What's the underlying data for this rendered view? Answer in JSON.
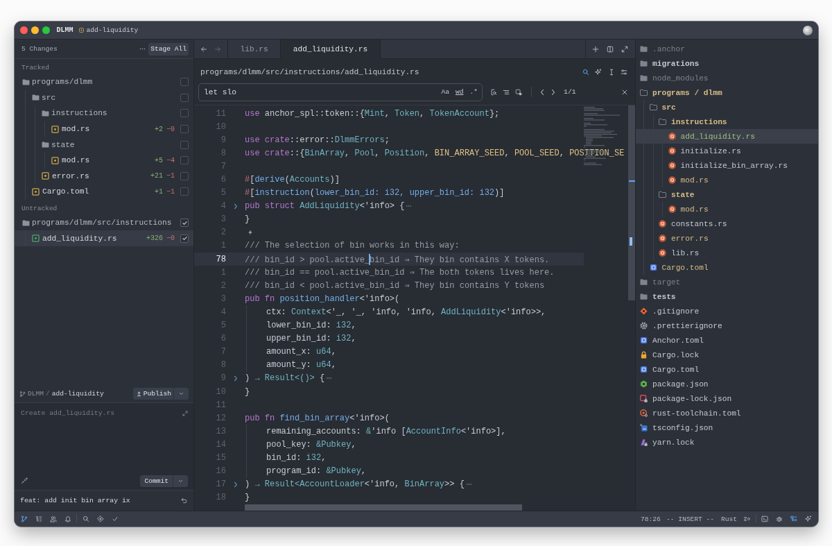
{
  "window": {
    "title": "DLMM",
    "branch": "add-liquidity"
  },
  "git_panel": {
    "summary": "5 Changes",
    "stage_all": "Stage All",
    "sections": [
      {
        "title": "Tracked",
        "items": [
          {
            "kind": "folder",
            "name": "programs/dlmm",
            "checked": false,
            "selected": false,
            "children": [
              {
                "kind": "folder",
                "name": "src",
                "checked": false,
                "selected": false,
                "children": [
                  {
                    "kind": "folder",
                    "name": "instructions",
                    "checked": false,
                    "selected": false,
                    "children": [
                      {
                        "kind": "file",
                        "name": "mod.rs",
                        "new_file": false,
                        "additions": "+2",
                        "deletions": "−0",
                        "checked": false,
                        "selected": false
                      }
                    ]
                  },
                  {
                    "kind": "folder",
                    "name": "state",
                    "checked": false,
                    "selected": false,
                    "children": [
                      {
                        "kind": "file",
                        "name": "mod.rs",
                        "new_file": false,
                        "additions": "+5",
                        "deletions": "−4",
                        "checked": false,
                        "selected": false
                      }
                    ]
                  },
                  {
                    "kind": "file",
                    "name": "error.rs",
                    "new_file": false,
                    "additions": "+21",
                    "deletions": "−1",
                    "checked": false,
                    "selected": false
                  }
                ]
              },
              {
                "kind": "file",
                "name": "Cargo.toml",
                "new_file": false,
                "additions": "+1",
                "deletions": "−1",
                "checked": false,
                "selected": false
              }
            ]
          }
        ]
      },
      {
        "title": "Untracked",
        "items": [
          {
            "kind": "folder",
            "name": "programs/dlmm/src/instructions",
            "checked": true,
            "selected": false,
            "children": [
              {
                "kind": "file",
                "name": "add_liquidity.rs",
                "new_file": true,
                "additions": "+326",
                "deletions": "−0",
                "checked": true,
                "selected": true
              }
            ]
          }
        ]
      }
    ],
    "repository": "DLMM",
    "separator": "/",
    "branch": "add-liquidity",
    "publish": "Publish",
    "commit_message": {
      "placeholder": "Create add_liquidity.rs"
    },
    "commit": "Commit",
    "last_commit": "feat: add init bin array ix"
  },
  "editor": {
    "back_enabled": true,
    "forward_enabled": false,
    "tabs": [
      {
        "label": "lib.rs",
        "selected": false
      },
      {
        "label": "add_liquidity.rs",
        "selected": true
      }
    ],
    "breadcrumb": "programs/dlmm/src/instructions/add_liquidity.rs",
    "search": {
      "active": true,
      "value": "let slo",
      "options": [
        "Aa",
        "wd",
        ".*"
      ],
      "matches": "1/1"
    },
    "lines": [
      {
        "number": "11",
        "current": false,
        "folded": false,
        "indented": false,
        "code_action": false,
        "tokens": [
          {
            "kind": "keyword",
            "text": "use"
          },
          {
            "kind": "plain",
            "text": " anchor_spl::token::{"
          },
          {
            "kind": "type",
            "text": "Mint"
          },
          {
            "kind": "plain",
            "text": ", "
          },
          {
            "kind": "type",
            "text": "Token"
          },
          {
            "kind": "plain",
            "text": ", "
          },
          {
            "kind": "type",
            "text": "TokenAccount"
          },
          {
            "kind": "plain",
            "text": "};"
          }
        ]
      },
      {
        "number": "10",
        "current": false,
        "folded": false,
        "indented": false,
        "code_action": false
      },
      {
        "number": "9",
        "current": false,
        "folded": false,
        "indented": false,
        "code_action": false,
        "tokens": [
          {
            "kind": "keyword",
            "text": "use crate"
          },
          {
            "kind": "plain",
            "text": "::error::"
          },
          {
            "kind": "type",
            "text": "DlmmErrors"
          },
          {
            "kind": "plain",
            "text": ";"
          }
        ]
      },
      {
        "number": "8",
        "current": false,
        "folded": false,
        "indented": false,
        "code_action": false,
        "tokens": [
          {
            "kind": "keyword",
            "text": "use crate"
          },
          {
            "kind": "plain",
            "text": "::{"
          },
          {
            "kind": "type",
            "text": "BinArray"
          },
          {
            "kind": "plain",
            "text": ", "
          },
          {
            "kind": "type",
            "text": "Pool"
          },
          {
            "kind": "plain",
            "text": ", "
          },
          {
            "kind": "type",
            "text": "Position"
          },
          {
            "kind": "plain",
            "text": ", "
          },
          {
            "kind": "constant",
            "text": "BIN_ARRAY_SEED"
          },
          {
            "kind": "plain",
            "text": ", "
          },
          {
            "kind": "constant",
            "text": "POOL_SEED"
          },
          {
            "kind": "plain",
            "text": ", "
          },
          {
            "kind": "constant",
            "text": "POSITION_SE"
          }
        ]
      },
      {
        "number": "7",
        "current": false,
        "folded": false,
        "indented": false,
        "code_action": false
      },
      {
        "number": "6",
        "current": false,
        "folded": false,
        "indented": false,
        "code_action": false,
        "tokens": [
          {
            "kind": "macro",
            "text": "#"
          },
          {
            "kind": "plain",
            "text": "["
          },
          {
            "kind": "function",
            "text": "derive"
          },
          {
            "kind": "plain",
            "text": "("
          },
          {
            "kind": "type",
            "text": "Accounts"
          },
          {
            "kind": "plain",
            "text": ")]"
          }
        ]
      },
      {
        "number": "5",
        "current": false,
        "folded": false,
        "indented": false,
        "code_action": false,
        "tokens": [
          {
            "kind": "macro",
            "text": "#"
          },
          {
            "kind": "plain",
            "text": "["
          },
          {
            "kind": "function",
            "text": "instruction"
          },
          {
            "kind": "plain",
            "text": "("
          },
          {
            "kind": "function",
            "text": "lower_bin_id: i32, upper_bin_id: i32"
          },
          {
            "kind": "plain",
            "text": ")]"
          }
        ]
      },
      {
        "number": "4",
        "current": false,
        "folded": true,
        "indented": false,
        "code_action": false,
        "tokens": [
          {
            "kind": "keyword",
            "text": "pub struct"
          },
          {
            "kind": "type",
            "text": " AddLiquidity"
          },
          {
            "kind": "plain",
            "text": "<'info> {"
          }
        ]
      },
      {
        "number": "3",
        "current": false,
        "folded": false,
        "indented": false,
        "code_action": false,
        "tokens": [
          {
            "kind": "plain",
            "text": "}"
          }
        ]
      },
      {
        "number": "2",
        "current": false,
        "folded": false,
        "indented": false,
        "code_action": true
      },
      {
        "number": "1",
        "current": false,
        "folded": false,
        "indented": false,
        "code_action": false,
        "tokens": [
          {
            "kind": "comment",
            "text": "/// The selection of bin works in this way:"
          }
        ]
      },
      {
        "number": "78",
        "current": true,
        "folded": false,
        "indented": false,
        "code_action": false,
        "tokens": [
          {
            "kind": "comment",
            "text": "/// bin_id > pool.active_"
          },
          {
            "kind": "cursor"
          },
          {
            "kind": "comment",
            "text": "bin_id ⇒ They bin contains X tokens."
          }
        ]
      },
      {
        "number": "1",
        "current": false,
        "folded": false,
        "indented": false,
        "code_action": false,
        "tokens": [
          {
            "kind": "comment",
            "text": "/// bin_id == pool.active_bin_id ⇒ The both tokens lives here."
          }
        ]
      },
      {
        "number": "2",
        "current": false,
        "folded": false,
        "indented": false,
        "code_action": false,
        "tokens": [
          {
            "kind": "comment",
            "text": "/// bin_id < pool.active_bin_id ⇒ They bin contains Y tokens"
          }
        ]
      },
      {
        "number": "3",
        "current": false,
        "folded": false,
        "indented": false,
        "code_action": false,
        "tokens": [
          {
            "kind": "keyword",
            "text": "pub fn"
          },
          {
            "kind": "function",
            "text": " position_handler"
          },
          {
            "kind": "plain",
            "text": "<'info>("
          }
        ]
      },
      {
        "number": "4",
        "current": false,
        "folded": false,
        "indented": true,
        "code_action": false,
        "tokens": [
          {
            "kind": "plain",
            "text": "ctx: "
          },
          {
            "kind": "type",
            "text": "Context"
          },
          {
            "kind": "plain",
            "text": "<'_, '_, 'info, 'info, "
          },
          {
            "kind": "type",
            "text": "AddLiquidity"
          },
          {
            "kind": "plain",
            "text": "<'info>>,"
          }
        ]
      },
      {
        "number": "5",
        "current": false,
        "folded": false,
        "indented": true,
        "code_action": false,
        "tokens": [
          {
            "kind": "plain",
            "text": "lower_bin_id: "
          },
          {
            "kind": "type",
            "text": "i32"
          },
          {
            "kind": "plain",
            "text": ","
          }
        ]
      },
      {
        "number": "6",
        "current": false,
        "folded": false,
        "indented": true,
        "code_action": false,
        "tokens": [
          {
            "kind": "plain",
            "text": "upper_bin_id: "
          },
          {
            "kind": "type",
            "text": "i32"
          },
          {
            "kind": "plain",
            "text": ","
          }
        ]
      },
      {
        "number": "7",
        "current": false,
        "folded": false,
        "indented": true,
        "code_action": false,
        "tokens": [
          {
            "kind": "plain",
            "text": "amount_x: "
          },
          {
            "kind": "type",
            "text": "u64"
          },
          {
            "kind": "plain",
            "text": ","
          }
        ]
      },
      {
        "number": "8",
        "current": false,
        "folded": false,
        "indented": true,
        "code_action": false,
        "tokens": [
          {
            "kind": "plain",
            "text": "amount_y: "
          },
          {
            "kind": "type",
            "text": "u64"
          },
          {
            "kind": "plain",
            "text": ","
          }
        ]
      },
      {
        "number": "9",
        "current": false,
        "folded": true,
        "indented": false,
        "code_action": false,
        "tokens": [
          {
            "kind": "plain",
            "text": ") "
          },
          {
            "kind": "type",
            "text": "→ Result<()>"
          },
          {
            "kind": "plain",
            "text": " {"
          }
        ]
      },
      {
        "number": "10",
        "current": false,
        "folded": false,
        "indented": false,
        "code_action": false,
        "tokens": [
          {
            "kind": "plain",
            "text": "}"
          }
        ]
      },
      {
        "number": "11",
        "current": false,
        "folded": false,
        "indented": false,
        "code_action": false
      },
      {
        "number": "12",
        "current": false,
        "folded": false,
        "indented": false,
        "code_action": false,
        "tokens": [
          {
            "kind": "keyword",
            "text": "pub fn"
          },
          {
            "kind": "function",
            "text": " find_bin_array"
          },
          {
            "kind": "plain",
            "text": "<'info>("
          }
        ]
      },
      {
        "number": "13",
        "current": false,
        "folded": false,
        "indented": true,
        "code_action": false,
        "tokens": [
          {
            "kind": "plain",
            "text": "remaining_accounts: "
          },
          {
            "kind": "type",
            "text": "&"
          },
          {
            "kind": "plain",
            "text": "'info ["
          },
          {
            "kind": "type",
            "text": "AccountInfo"
          },
          {
            "kind": "plain",
            "text": "<'info>],"
          }
        ]
      },
      {
        "number": "14",
        "current": false,
        "folded": false,
        "indented": true,
        "code_action": false,
        "tokens": [
          {
            "kind": "plain",
            "text": "pool_key: "
          },
          {
            "kind": "type",
            "text": "&Pubkey"
          },
          {
            "kind": "plain",
            "text": ","
          }
        ]
      },
      {
        "number": "15",
        "current": false,
        "folded": false,
        "indented": true,
        "code_action": false,
        "tokens": [
          {
            "kind": "plain",
            "text": "bin_id: "
          },
          {
            "kind": "type",
            "text": "i32"
          },
          {
            "kind": "plain",
            "text": ","
          }
        ]
      },
      {
        "number": "16",
        "current": false,
        "folded": false,
        "indented": true,
        "code_action": false,
        "tokens": [
          {
            "kind": "plain",
            "text": "program_id: "
          },
          {
            "kind": "type",
            "text": "&Pubkey"
          },
          {
            "kind": "plain",
            "text": ","
          }
        ]
      },
      {
        "number": "17",
        "current": false,
        "folded": true,
        "indented": false,
        "code_action": false,
        "tokens": [
          {
            "kind": "plain",
            "text": ") "
          },
          {
            "kind": "type",
            "text": "→ Result<AccountLoader"
          },
          {
            "kind": "plain",
            "text": "<'info, "
          },
          {
            "kind": "type",
            "text": "BinArray"
          },
          {
            "kind": "plain",
            "text": ">> {"
          }
        ]
      },
      {
        "number": "18",
        "current": false,
        "folded": false,
        "indented": false,
        "code_action": false,
        "tokens": [
          {
            "kind": "plain",
            "text": "}"
          }
        ]
      }
    ]
  },
  "project_tree": {
    "items": [
      {
        "kind": "folder",
        "name": ".anchor",
        "ignored": true,
        "expanded": false,
        "selected": false
      },
      {
        "kind": "folder",
        "name": "migrations",
        "ignored": false,
        "color": "#c5c9d1",
        "expanded": false,
        "selected": false
      },
      {
        "kind": "folder",
        "name": "node_modules",
        "ignored": true,
        "expanded": false,
        "selected": false
      },
      {
        "kind": "folder",
        "name": "programs / dlmm",
        "ignored": false,
        "color": "#d6bd86",
        "expanded": true,
        "selected": false,
        "children": [
          {
            "kind": "folder",
            "name": "src",
            "ignored": false,
            "color": "#d6bd86",
            "expanded": true,
            "selected": false,
            "children": [
              {
                "kind": "folder",
                "name": "instructions",
                "ignored": false,
                "color": "#d6bd86",
                "expanded": true,
                "selected": false,
                "children": [
                  {
                    "kind": "rust",
                    "name": "add_liquidity.rs",
                    "ignored": false,
                    "color": "#9ec27e",
                    "selected": true
                  },
                  {
                    "kind": "rust",
                    "name": "initialize.rs",
                    "ignored": false,
                    "color": "#c5c9d1",
                    "selected": false
                  },
                  {
                    "kind": "rust",
                    "name": "initialize_bin_array.rs",
                    "ignored": false,
                    "color": "#c5c9d1",
                    "selected": false
                  },
                  {
                    "kind": "rust",
                    "name": "mod.rs",
                    "ignored": false,
                    "color": "#d6bd86",
                    "selected": false
                  }
                ]
              },
              {
                "kind": "folder",
                "name": "state",
                "ignored": false,
                "color": "#d6bd86",
                "expanded": true,
                "selected": false,
                "children": [
                  {
                    "kind": "rust",
                    "name": "mod.rs",
                    "ignored": false,
                    "color": "#d6bd86",
                    "selected": false
                  }
                ]
              },
              {
                "kind": "rust",
                "name": "constants.rs",
                "ignored": false,
                "color": "#c5c9d1",
                "selected": false
              },
              {
                "kind": "rust",
                "name": "error.rs",
                "ignored": false,
                "color": "#d6bd86",
                "selected": false
              },
              {
                "kind": "rust",
                "name": "lib.rs",
                "ignored": false,
                "color": "#c5c9d1",
                "selected": false
              }
            ]
          },
          {
            "kind": "toml",
            "name": "Cargo.toml",
            "ignored": false,
            "color": "#d6bd86",
            "selected": false
          }
        ]
      },
      {
        "kind": "folder",
        "name": "target",
        "ignored": true,
        "expanded": false,
        "selected": false
      },
      {
        "kind": "folder",
        "name": "tests",
        "ignored": false,
        "color": "#c5c9d1",
        "expanded": false,
        "selected": false
      },
      {
        "kind": "git",
        "name": ".gitignore",
        "ignored": false,
        "color": "#c5c9d1",
        "selected": false
      },
      {
        "kind": "prettier",
        "name": ".prettierignore",
        "ignored": false,
        "color": "#c5c9d1",
        "selected": false
      },
      {
        "kind": "toml",
        "name": "Anchor.toml",
        "ignored": false,
        "color": "#c5c9d1",
        "selected": false
      },
      {
        "kind": "lock",
        "name": "Cargo.lock",
        "ignored": false,
        "color": "#c5c9d1",
        "selected": false
      },
      {
        "kind": "toml",
        "name": "Cargo.toml",
        "ignored": false,
        "color": "#c5c9d1",
        "selected": false
      },
      {
        "kind": "npm",
        "name": "package.json",
        "ignored": false,
        "color": "#c5c9d1",
        "selected": false
      },
      {
        "kind": "npm-lock",
        "name": "package-lock.json",
        "ignored": false,
        "color": "#c5c9d1",
        "selected": false
      },
      {
        "kind": "rust-toolchain",
        "name": "rust-toolchain.toml",
        "ignored": false,
        "color": "#c5c9d1",
        "selected": false
      },
      {
        "kind": "tsconfig",
        "name": "tsconfig.json",
        "ignored": false,
        "color": "#c5c9d1",
        "selected": false
      },
      {
        "kind": "yarn-lock",
        "name": "yarn.lock",
        "ignored": false,
        "color": "#c5c9d1",
        "selected": false
      }
    ]
  },
  "status_bar": {
    "panels": [
      {
        "kind": "git",
        "on": true
      },
      {
        "kind": "outline",
        "on": false
      },
      {
        "kind": "people",
        "on": false
      },
      {
        "kind": "bell",
        "on": false
      }
    ],
    "tools": [
      {
        "kind": "search",
        "on": false
      },
      {
        "kind": "diamond",
        "on": false
      },
      {
        "kind": "check",
        "on": false
      }
    ],
    "position": "78:26",
    "mode": "-- INSERT --",
    "language": "Rust",
    "docks": [
      {
        "kind": "terminal",
        "on": false
      },
      {
        "kind": "bug",
        "on": false
      },
      {
        "kind": "project",
        "on": true
      },
      {
        "kind": "sparkle",
        "on": false
      }
    ]
  }
}
